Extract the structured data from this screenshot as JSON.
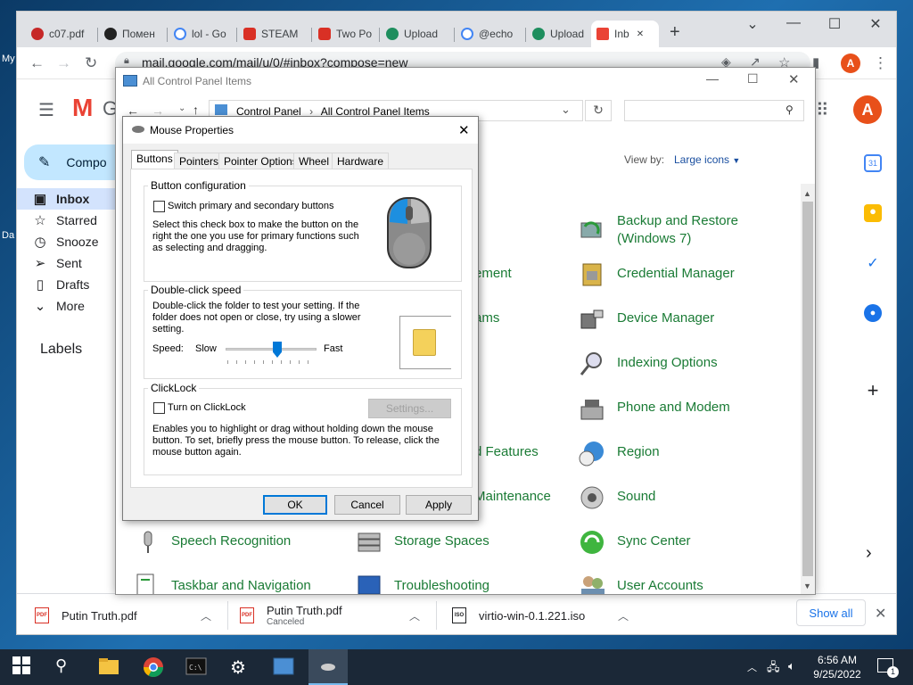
{
  "desktop": {
    "labels": [
      "My",
      "Da"
    ]
  },
  "browser": {
    "tabs": [
      {
        "label": "c07.pdf",
        "color": "#c62828"
      },
      {
        "label": "Помен",
        "color": "#222222"
      },
      {
        "label": "lol - Go",
        "color": "#4285f4"
      },
      {
        "label": "STEAM",
        "color": "#d93025"
      },
      {
        "label": "Two Po",
        "color": "#d93025"
      },
      {
        "label": "Upload",
        "color": "#1e8e5e"
      },
      {
        "label": "@echo",
        "color": "#4285f4"
      },
      {
        "label": "Upload",
        "color": "#1e8e5e"
      },
      {
        "label": "Inb",
        "color": "#ea4335"
      }
    ],
    "new_tab": "+",
    "url": "mail.google.com/mail/u/0/#inbox?compose=new",
    "profile_initial": "A"
  },
  "gmail": {
    "logo_letter": "M",
    "logo_text": "G",
    "compose": "Compo",
    "nav": [
      {
        "label": "Inbox",
        "icon": "inbox-icon",
        "glyph": "▣"
      },
      {
        "label": "Starred",
        "icon": "star-icon",
        "glyph": "☆"
      },
      {
        "label": "Snooze",
        "icon": "clock-icon",
        "glyph": "◷"
      },
      {
        "label": "Sent",
        "icon": "send-icon",
        "glyph": "➢"
      },
      {
        "label": "Drafts",
        "icon": "draft-icon",
        "glyph": "▯"
      },
      {
        "label": "More",
        "icon": "chevron-down-icon",
        "glyph": "⌄"
      }
    ],
    "labels_heading": "Labels",
    "profile_initial": "A",
    "rail": {
      "calendar_day": "31",
      "add": "+"
    },
    "scroll_arrow": "›"
  },
  "downloads": {
    "items": [
      {
        "name": "Putin Truth.pdf",
        "status": ""
      },
      {
        "name": "Putin Truth.pdf",
        "status": "Canceled"
      },
      {
        "name": "virtio-win-0.1.221.iso",
        "status": ""
      }
    ],
    "show_all": "Show all",
    "close": "✕"
  },
  "control_panel": {
    "title": "All Control Panel Items",
    "breadcrumb": [
      "Control Panel",
      "All Control Panel Items"
    ],
    "view_by_label": "View by:",
    "view_by_value": "Large icons",
    "items": [
      {
        "label": "Backup and Restore",
        "label2": "(Windows 7)"
      },
      {
        "label": "ement"
      },
      {
        "label": "Credential Manager"
      },
      {
        "label": "ams"
      },
      {
        "label": "Device Manager"
      },
      {
        "label": "Indexing Options"
      },
      {
        "label": "Phone and Modem"
      },
      {
        "label": "d Features"
      },
      {
        "label": "Region"
      },
      {
        "label": "Maintenance"
      },
      {
        "label": "Sound"
      },
      {
        "label": "Speech Recognition"
      },
      {
        "label": "Storage Spaces"
      },
      {
        "label": "Sync Center"
      },
      {
        "label": "Taskbar and Navigation"
      },
      {
        "label": "Troubleshooting"
      },
      {
        "label": "User Accounts"
      }
    ]
  },
  "mouse_properties": {
    "title": "Mouse Properties",
    "tabs": [
      "Buttons",
      "Pointers",
      "Pointer Options",
      "Wheel",
      "Hardware"
    ],
    "button_config": {
      "heading": "Button configuration",
      "checkbox_label": "Switch primary and secondary buttons",
      "checked": false,
      "description": "Select this check box to make the button on the right the one you use for primary functions such as selecting and dragging."
    },
    "double_click": {
      "heading": "Double-click speed",
      "description": "Double-click the folder to test your setting. If the folder does not open or close, try using a slower setting.",
      "speed_label": "Speed:",
      "slow": "Slow",
      "fast": "Fast",
      "speed_fraction": 0.58
    },
    "clicklock": {
      "heading": "ClickLock",
      "checkbox_label": "Turn on ClickLock",
      "checked": false,
      "settings_button": "Settings...",
      "description": "Enables you to highlight or drag without holding down the mouse button. To set, briefly press the mouse button. To release, click the mouse button again."
    },
    "buttons": {
      "ok": "OK",
      "cancel": "Cancel",
      "apply": "Apply"
    }
  },
  "taskbar": {
    "time": "6:56 AM",
    "date": "9/25/2022",
    "notification_count": "1"
  }
}
